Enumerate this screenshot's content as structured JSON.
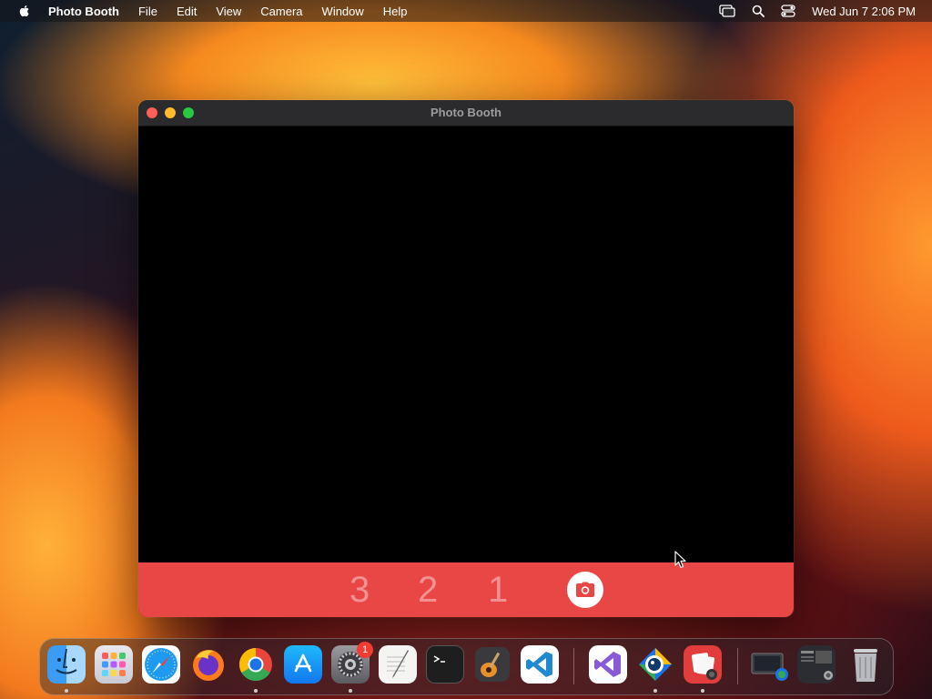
{
  "menubar": {
    "app_name": "Photo Booth",
    "items": [
      "File",
      "Edit",
      "View",
      "Camera",
      "Window",
      "Help"
    ],
    "clock": "Wed Jun 7  2:06 PM"
  },
  "window": {
    "title": "Photo Booth",
    "countdown": [
      "3",
      "2",
      "1"
    ]
  },
  "dock": {
    "apps": [
      "Finder",
      "Launchpad",
      "Safari",
      "Firefox",
      "Google Chrome",
      "App Store",
      "System Settings",
      "TextEdit",
      "Terminal",
      "GarageBand",
      "Visual Studio Code",
      "Visual Studio",
      "Chrome Remote",
      "Photo Booth",
      "Screen Capture",
      "Recent Window",
      "Trash"
    ],
    "settings_badge": "1"
  },
  "colors": {
    "control_bar": "#e94646",
    "countdown_text": "#f29191",
    "traffic_close": "#fe5f57",
    "traffic_minimize": "#febc2e",
    "traffic_maximize": "#28c840"
  }
}
